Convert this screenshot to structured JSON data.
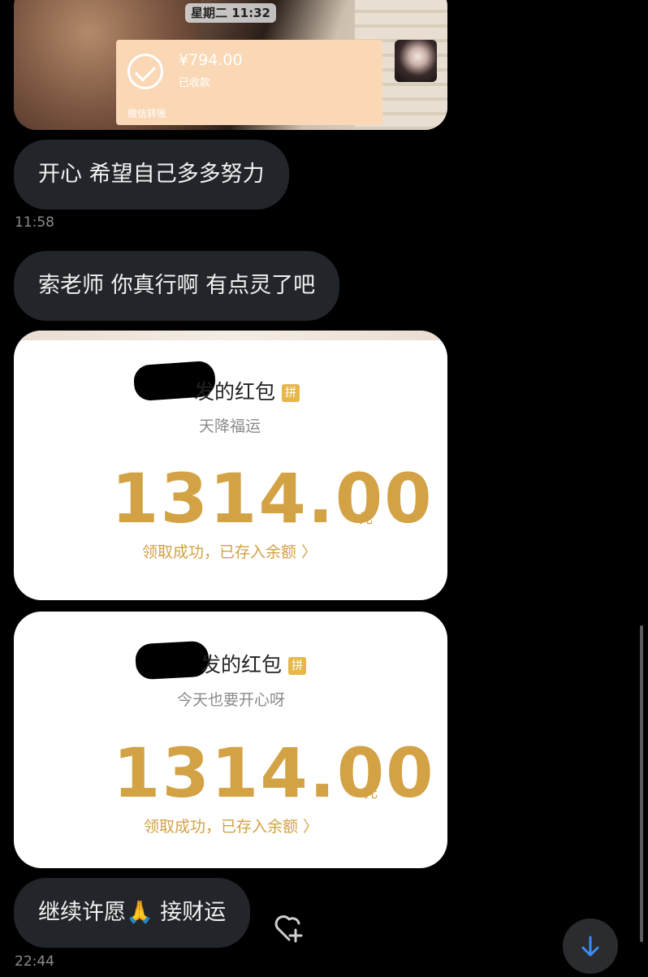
{
  "photo_card": {
    "timestamp": "星期二 11:32",
    "transfer": {
      "amount": "¥794.00",
      "status": "已收款",
      "source": "微信转账"
    }
  },
  "messages": [
    {
      "text": "开心 希望自己多多努力",
      "time": "11:58"
    },
    {
      "text": "索老师 你真行啊 有点灵了吧"
    }
  ],
  "red_packets": [
    {
      "title_suffix": "发的红包",
      "badge": "拼",
      "subtitle": "天降福运",
      "amount": "1314.00",
      "unit": "元",
      "status": "领取成功，已存入余额 〉"
    },
    {
      "title_suffix": "发的红包",
      "badge": "拼",
      "subtitle": "今天也要开心呀",
      "amount": "1314.00",
      "unit": "元",
      "status": "领取成功，已存入余额 〉"
    }
  ],
  "last_message": {
    "text": "继续许愿🙏 接财运",
    "time": "22:44"
  },
  "icons": {
    "react": "heart-plus-icon",
    "scroll": "arrow-down-icon",
    "accent": "#3b8df0",
    "gold": "#d2a245"
  }
}
